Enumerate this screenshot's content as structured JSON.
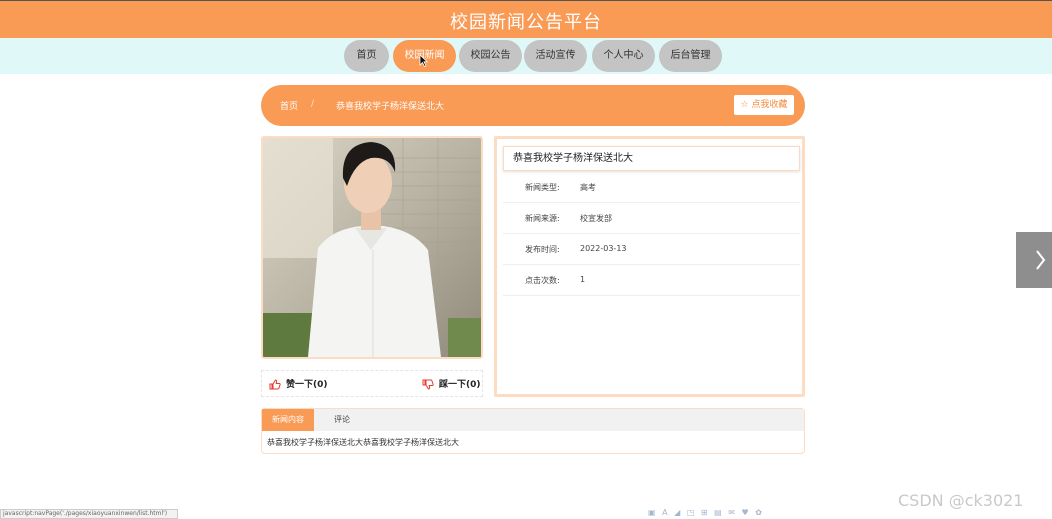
{
  "header": {
    "title": "校园新闻公告平台"
  },
  "nav": [
    {
      "label": "首页",
      "active": false
    },
    {
      "label": "校园新闻",
      "active": true
    },
    {
      "label": "校园公告",
      "active": false
    },
    {
      "label": "活动宣传",
      "active": false
    },
    {
      "label": "个人中心",
      "active": false
    },
    {
      "label": "后台管理",
      "active": false
    }
  ],
  "breadcrumb": {
    "home": "首页",
    "separator": "/",
    "current": "恭喜我校学子杨洋保送北大"
  },
  "favorite_label": "☆ 点我收藏",
  "votes": {
    "like_label": "赞一下(0)",
    "dislike_label": "踩一下(0)"
  },
  "article": {
    "title": "恭喜我校学子杨洋保送北大",
    "fields": [
      {
        "key": "新闻类型:",
        "value": "高考"
      },
      {
        "key": "新闻来源:",
        "value": "校宣发部"
      },
      {
        "key": "发布时间:",
        "value": "2022-03-13"
      },
      {
        "key": "点击次数:",
        "value": "1"
      }
    ]
  },
  "tabs": {
    "content_tab": "新闻内容",
    "comment_tab": "评论"
  },
  "content_text": "恭喜我校学子杨洋保送北大恭喜我校学子杨洋保送北大",
  "status_url": "javascript:navPage('./pages/xiaoyuanxinwen/list.html')",
  "watermark": "CSDN @ck3021",
  "toolbar_glyphs": "▣ A ◢ ◳ ⊞ ▤ ✉ ♥ ✿",
  "colors": {
    "accent": "#f99a55",
    "nav_bg": "#e0f8f8",
    "nav_pill": "#c4c4c4",
    "border": "#fcdcc3"
  }
}
